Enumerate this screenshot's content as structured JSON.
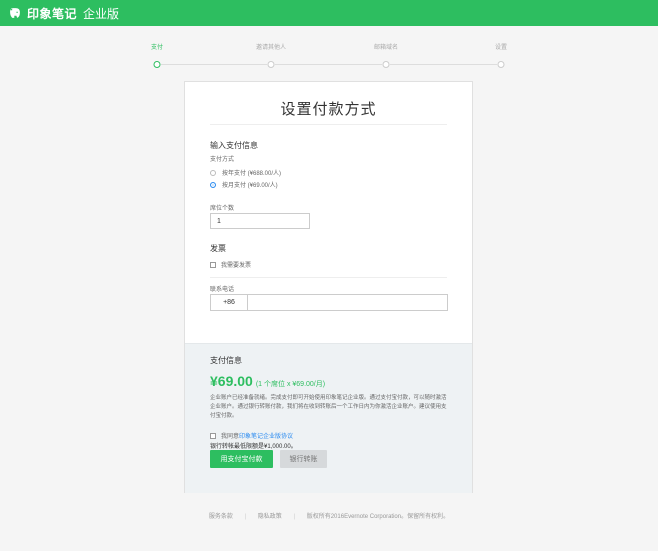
{
  "header": {
    "brand": "印象笔记",
    "edition": "企业版",
    "brand_color": "#2dbe60",
    "logo_icon": "elephant-logo-icon"
  },
  "stepper": {
    "steps": [
      "支付",
      "邀请其他人",
      "邮箱域名",
      "设置"
    ],
    "active_index": 0
  },
  "form": {
    "title": "设置付款方式",
    "payment_section": "输入支付信息",
    "payment_method_label": "支付方式",
    "options": [
      {
        "label": "按年支付 (¥688.00/人)",
        "selected": false
      },
      {
        "label": "按月支付 (¥69.00/人)",
        "selected": true
      }
    ],
    "seats_label": "席位个数",
    "seats_value": "1",
    "invoice_section": "发票",
    "invoice_checkbox": "我需要发票",
    "phone_label": "联系电话",
    "phone_code": "+86",
    "phone_value": ""
  },
  "payment_info": {
    "title": "支付信息",
    "price": "¥69.00",
    "price_detail": "(1 个席位 x ¥69.00/月)",
    "description": "企业账户已经准备就绪。完成支付即可开始使用印象笔记企业版。通过支付宝付款，可以随时激活企业账户。通过银行转账付款，我们将在收到转账后一个工作日内为你激活企业账户。建议使用支付宝付款。",
    "agree_prefix": "我同意",
    "agree_link": "印象笔记企业版协议",
    "bank_minimum": "银行转帐最低限额是¥1,000.00。",
    "alipay_button": "用支付宝付款",
    "bank_button": "银行转账"
  },
  "footer": {
    "terms": "服务条款",
    "privacy": "隐私政策",
    "copyright": "版权所有2016Evernote Corporation。保留所有权利。"
  }
}
